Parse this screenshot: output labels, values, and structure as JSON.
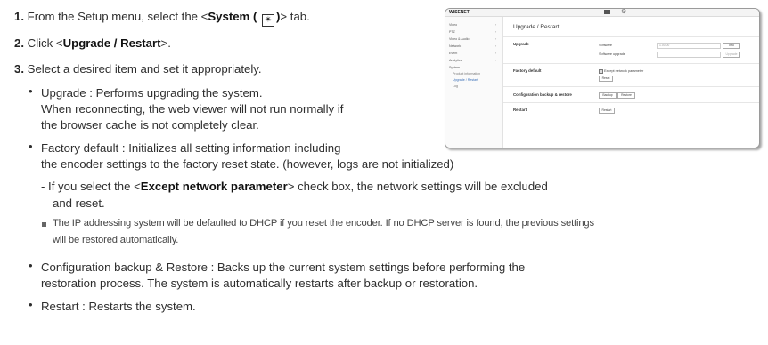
{
  "steps": [
    {
      "num": "1.",
      "pre": "From the Setup menu, select the <",
      "bold": "System (",
      "bold_end": ")",
      "post": "> tab."
    },
    {
      "num": "2.",
      "pre": "Click <",
      "bold": "Upgrade / Restart",
      "post": ">."
    },
    {
      "num": "3.",
      "text": "Select a desired item and set it appropriately."
    }
  ],
  "bullets": {
    "upgrade": [
      "Upgrade : Performs upgrading the system.",
      "When reconnecting, the web viewer will not run normally if",
      "the browser cache is not completely clear."
    ],
    "factory": [
      "Factory default : Initializes all setting information including",
      "the encoder settings to the factory reset state. (however, logs are not initialized)"
    ],
    "except_pre": "- If you select the <",
    "except_bold": "Except network parameter",
    "except_post": "> check box, the network settings will be excluded",
    "except_line2": "and reset.",
    "note": [
      "The IP addressing system will be defaulted to DHCP if you reset the encoder. If no DHCP server is found, the previous settings",
      "will be restored automatically."
    ],
    "config": [
      "Configuration backup & Restore : Backs up the current system settings before performing the",
      "restoration process. The system is automatically restarts after backup or restoration."
    ],
    "restart": "Restart : Restarts the system."
  },
  "screenshot": {
    "logo": "WISENET",
    "menu": [
      "Video",
      "PTZ",
      "Video & Audio",
      "Network",
      "Event",
      "Analytics",
      "System"
    ],
    "submenu": [
      "Product information",
      "Upgrade / Restart",
      "Log"
    ],
    "page_title": "Upgrade / Restart",
    "sections": {
      "upgrade": "Upgrade",
      "software": "Software",
      "software_upgrade": "Software upgrade",
      "software_value": "1.00.00",
      "info_btn": "Info",
      "upgrade_btn": "Upgrade",
      "factory": "Factory default",
      "except": "Except network parameter",
      "reset_btn": "Reset",
      "config": "Configuration backup & restore",
      "backup_btn": "Backup",
      "restore_btn": "Restore",
      "restart": "Restart",
      "restart_btn": "Restart"
    }
  }
}
